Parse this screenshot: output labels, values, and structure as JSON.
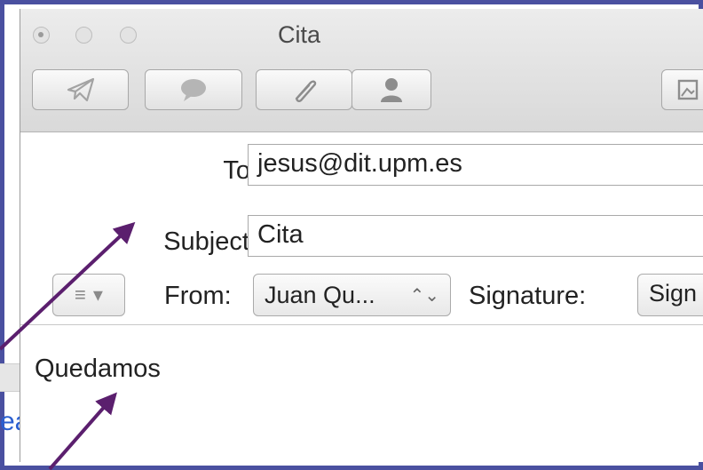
{
  "window": {
    "title": "Cita"
  },
  "toolbar": {
    "buttons": [
      {
        "name": "send",
        "icon": "send-icon"
      },
      {
        "name": "chat",
        "icon": "chat-bubble-icon"
      },
      {
        "name": "attach",
        "icon": "paperclip-icon"
      },
      {
        "name": "address",
        "icon": "person-icon"
      },
      {
        "name": "photo",
        "icon": "photo-browser-icon"
      }
    ]
  },
  "fields": {
    "to_label": "To:",
    "to_value": "jesus@dit.upm.es",
    "subject_label": "Subject:",
    "subject_value": "Cita"
  },
  "options": {
    "list_icon": "≡",
    "list_chevron": "▾",
    "from_label": "From:",
    "from_value": "Juan Qu...",
    "from_arrows": "⌃⌄",
    "signature_label": "Signature:",
    "signature_value": "Sign"
  },
  "body": {
    "text": "Quedamos"
  },
  "background": {
    "partial_text": "ea"
  },
  "colors": {
    "frame": "#4a50a0",
    "annotation_arrow": "#5b1f6e",
    "link_text": "#2a5fd0"
  }
}
